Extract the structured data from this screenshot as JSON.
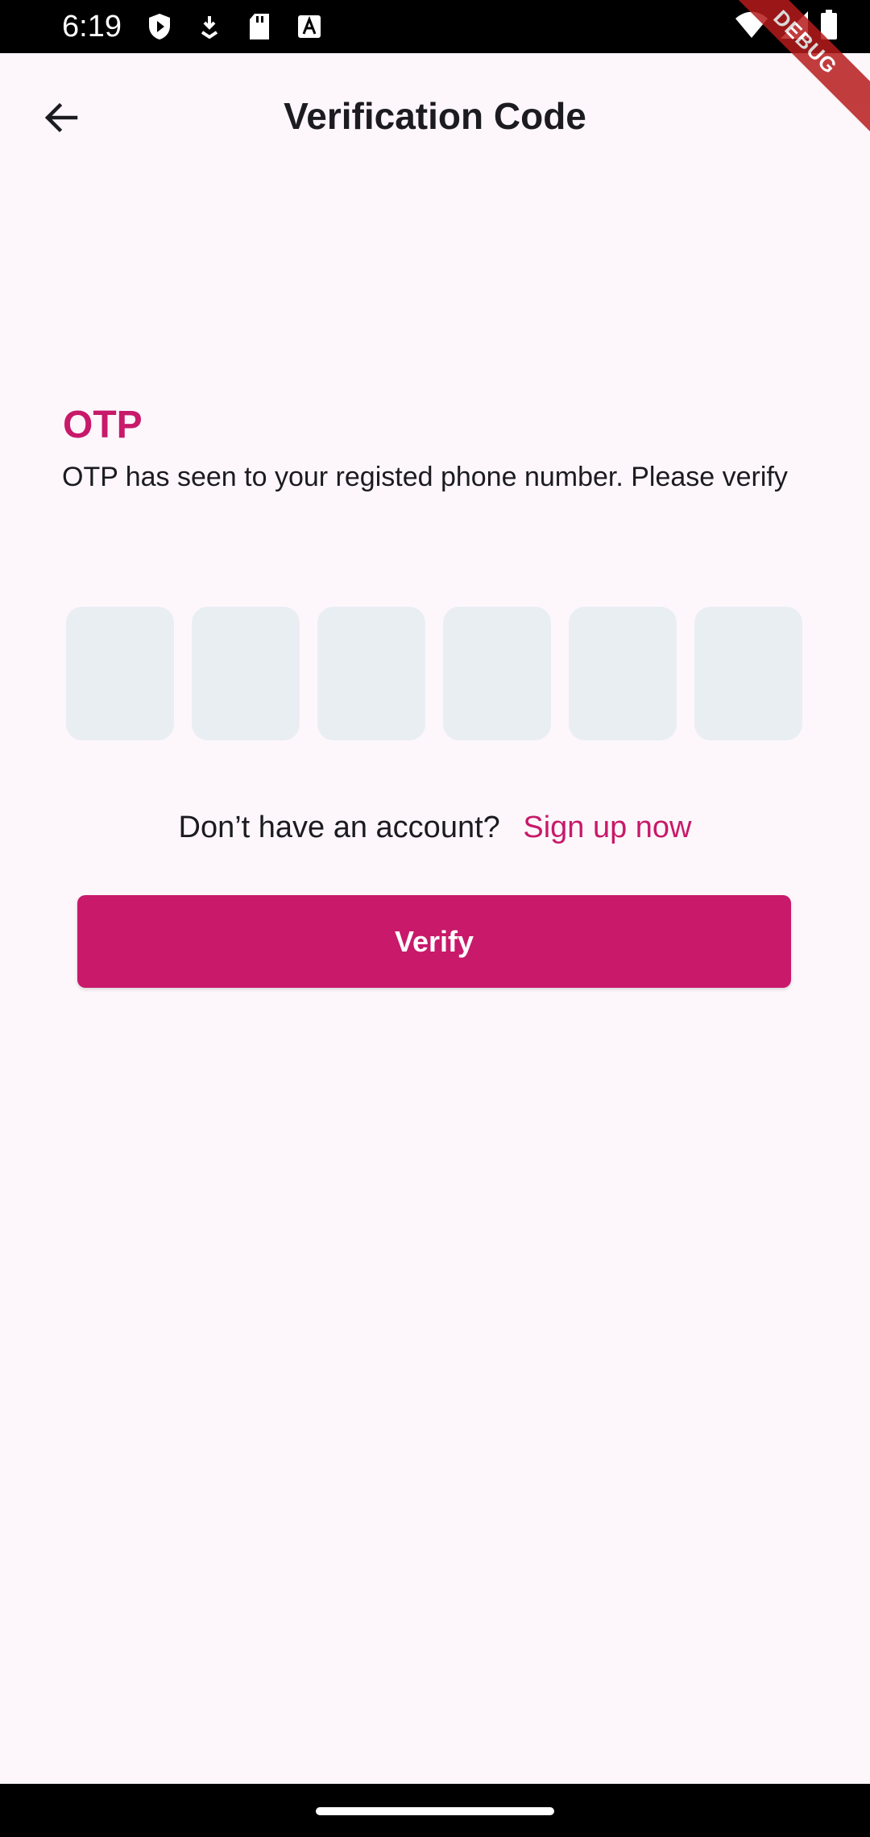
{
  "status_bar": {
    "time": "6:19",
    "left_icons": [
      "shield-icon",
      "download-icon",
      "sd-card-icon",
      "font-icon"
    ],
    "right_icons": [
      "wifi-icon",
      "signal-icon",
      "battery-icon"
    ]
  },
  "debug_banner": "DEBUG",
  "app_bar": {
    "back_icon": "arrow-back-icon",
    "title": "Verification Code"
  },
  "otp": {
    "heading": "OTP",
    "description": "OTP has seen to your registed phone number. Please verify",
    "boxes": [
      "",
      "",
      "",
      "",
      "",
      ""
    ]
  },
  "signup": {
    "prompt": "Don’t have an account?",
    "link": "Sign up now"
  },
  "verify_button": "Verify",
  "colors": {
    "accent": "#c8196a",
    "background": "#fdf7fb",
    "otp_box": "#e9eef3"
  }
}
